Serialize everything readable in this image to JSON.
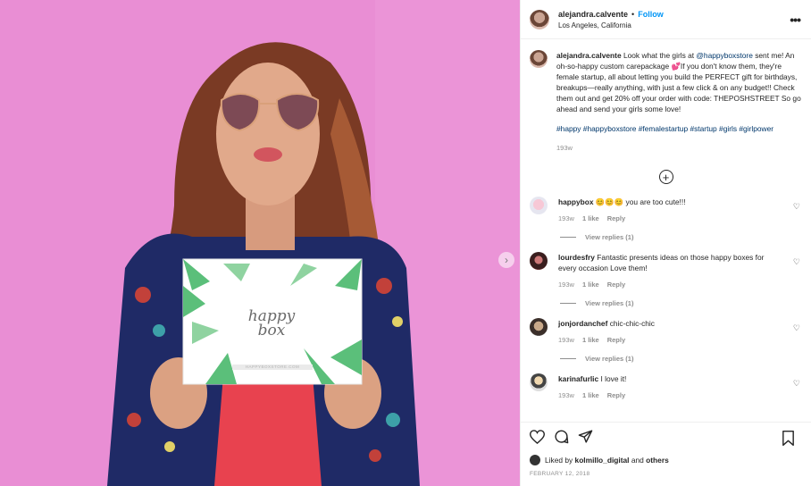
{
  "post": {
    "username": "alejandra.calvente",
    "follow_label": "Follow",
    "location": "Los Angeles, California",
    "more_label": "•••",
    "next_label": "›",
    "caption": {
      "username": "alejandra.calvente",
      "text_before": "Look what the girls at ",
      "mention": "@happyboxstore",
      "text_after": " sent me! An oh-so-happy custom carepackage 💕If you don't know them, they're female startup, all about letting you build the PERFECT gift for birthdays, breakups—really anything, with just a few click & on any budget!! Check them out and get 20% off your order with code: THEPOSHSTREET So go ahead and send your girls some love!",
      "hashtags": "#happy #happyboxstore #femalestartup #startup #girls #girlpower",
      "time": "193w"
    },
    "load_more": "+",
    "box_text_1": "happy",
    "box_text_2": "box",
    "box_url": "HAPPYBOXSTORE.COM"
  },
  "comments": [
    {
      "username": "happybox",
      "text": "😊😊😊 you are too cute!!!",
      "time": "193w",
      "likes": "1 like",
      "reply": "Reply",
      "view_replies": "View replies (1)"
    },
    {
      "username": "lourdesfry",
      "text": "Fantastic presents ideas on those happy boxes for every occasion Love them!",
      "time": "193w",
      "likes": "1 like",
      "reply": "Reply",
      "view_replies": "View replies (1)"
    },
    {
      "username": "jonjordanchef",
      "text": "chic-chic-chic",
      "time": "193w",
      "likes": "1 like",
      "reply": "Reply",
      "view_replies": "View replies (1)"
    },
    {
      "username": "karinafurlic",
      "text": "I love it!",
      "time": "193w",
      "likes": "1 like",
      "reply": "Reply"
    }
  ],
  "footer": {
    "liked_prefix": "Liked by ",
    "liked_user": "kolmillo_digital",
    "liked_and": " and ",
    "liked_others": "others",
    "date": "FEBRUARY 12, 2018"
  },
  "icons": {
    "heart": "heart-icon",
    "comment": "comment-icon",
    "share": "share-icon",
    "bookmark": "bookmark-icon",
    "plus": "plus-circle-icon"
  },
  "colors": {
    "follow": "#0095f6",
    "link": "#00376b",
    "muted": "#8e8e8e",
    "wall": "#e98ed4"
  }
}
